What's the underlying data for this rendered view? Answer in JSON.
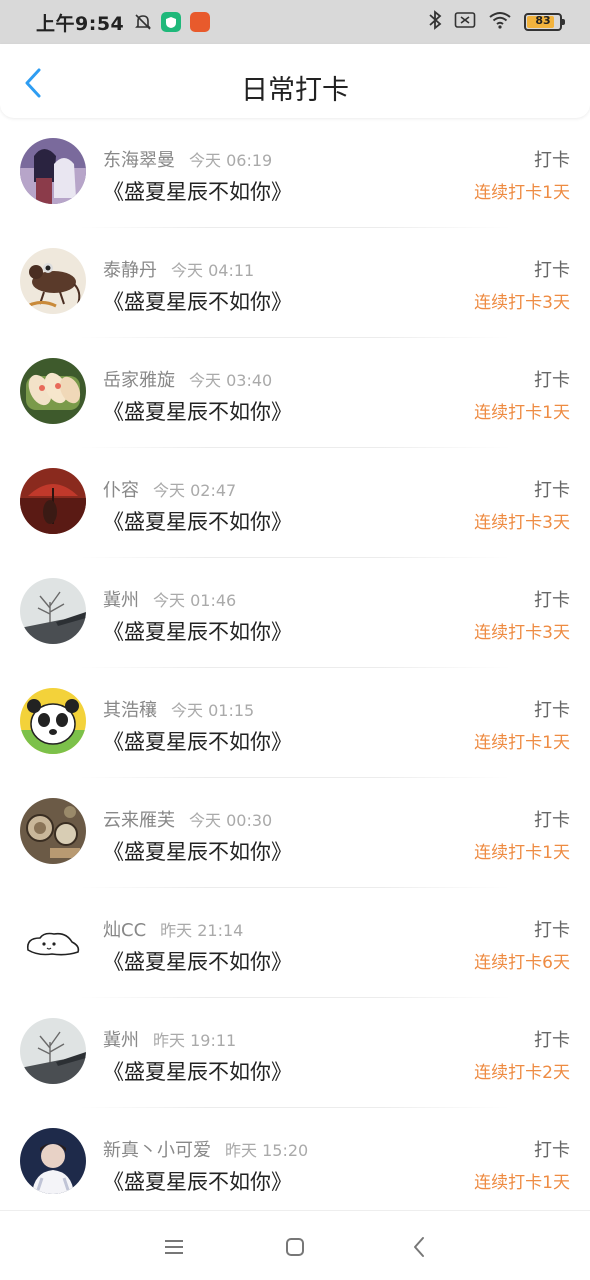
{
  "status_bar": {
    "time": "上午9:54",
    "battery_level": "83",
    "icons": [
      "mute-bell-icon",
      "shield-icon",
      "app-icon",
      "bluetooth-icon",
      "sim-icon",
      "wifi-icon",
      "battery-icon"
    ]
  },
  "header": {
    "title": "日常打卡",
    "back_icon": "chevron-left-icon"
  },
  "colors": {
    "accent_orange": "#ee8b42",
    "back_blue": "#2e9df2"
  },
  "checkins": [
    {
      "name": "东海翠曼",
      "time": "今天 06:19",
      "book": "《盛夏星辰不如你》",
      "action": "打卡",
      "streak": "连续打卡1天",
      "avatar": "anime-couple"
    },
    {
      "name": "泰静丹",
      "time": "今天 04:11",
      "book": "《盛夏星辰不如你》",
      "action": "打卡",
      "streak": "连续打卡3天",
      "avatar": "mouse-drawing"
    },
    {
      "name": "岳家雅旋",
      "time": "今天 03:40",
      "book": "《盛夏星辰不如你》",
      "action": "打卡",
      "streak": "连续打卡1天",
      "avatar": "food-rolls"
    },
    {
      "name": "仆容",
      "time": "今天 02:47",
      "book": "《盛夏星辰不如你》",
      "action": "打卡",
      "streak": "连续打卡3天",
      "avatar": "red-umbrella"
    },
    {
      "name": "冀州",
      "time": "今天 01:46",
      "book": "《盛夏星辰不如你》",
      "action": "打卡",
      "streak": "连续打卡3天",
      "avatar": "winter-tree"
    },
    {
      "name": "其浩穰",
      "time": "今天 01:15",
      "book": "《盛夏星辰不如你》",
      "action": "打卡",
      "streak": "连续打卡1天",
      "avatar": "panda"
    },
    {
      "name": "云来雁芙",
      "time": "今天 00:30",
      "book": "《盛夏星辰不如你》",
      "action": "打卡",
      "streak": "连续打卡1天",
      "avatar": "vintage-items"
    },
    {
      "name": "灿CC",
      "time": "昨天 21:14",
      "book": "《盛夏星辰不如你》",
      "action": "打卡",
      "streak": "连续打卡6天",
      "avatar": "cartoon-blob"
    },
    {
      "name": "冀州",
      "time": "昨天 19:11",
      "book": "《盛夏星辰不如你》",
      "action": "打卡",
      "streak": "连续打卡2天",
      "avatar": "winter-tree"
    },
    {
      "name": "新真丶小可爱",
      "time": "昨天 15:20",
      "book": "《盛夏星辰不如你》",
      "action": "打卡",
      "streak": "连续打卡1天",
      "avatar": "portrait"
    }
  ],
  "nav_bar": {
    "buttons": [
      "menu-icon",
      "home-square-icon",
      "back-chevron-icon"
    ]
  }
}
